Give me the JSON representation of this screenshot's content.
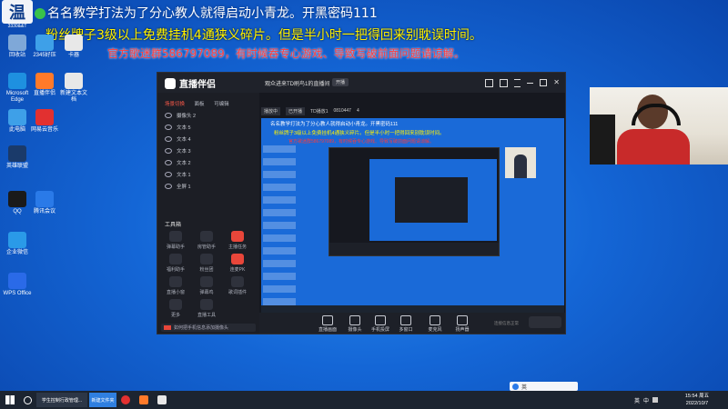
{
  "overlay": {
    "line1": "名名教学打法为了分心教人就得启动小青龙。开黑密码111",
    "line2": "粉丝牌子3级以上免费挂机4通狭义碎片。但是半小时一把得回来别耽误时间。",
    "line3": "官方歌迷群586797089，有时候吞专心游戏、导致写破前面问题请谅解。"
  },
  "corner_logo": {
    "text": "温",
    "sub": "3330&&T"
  },
  "desktop_icons": [
    {
      "label": "回收站",
      "color": "#7fa8d8"
    },
    {
      "label": "2345好压",
      "color": "#3ea0e8"
    },
    {
      "label": "卡器",
      "color": "#e8e8e8"
    },
    {
      "label": "Microsoft Edge",
      "color": "#1e90e0"
    },
    {
      "label": "直播伴侣",
      "color": "#ff7a2a"
    },
    {
      "label": "新建文本文档",
      "color": "#e8e8e8"
    },
    {
      "label": "此电脑",
      "color": "#3ea0e8"
    },
    {
      "label": "网易云音乐",
      "color": "#e23030"
    },
    {
      "label": "英雄联盟",
      "color": "#1a3a6a"
    },
    {
      "label": "QQ",
      "color": "#1a1a1a"
    },
    {
      "label": "腾讯会议",
      "color": "#2a7ae8"
    },
    {
      "label": "企业微信",
      "color": "#2a9ae8"
    },
    {
      "label": "WPS Office",
      "color": "#2a6ae8"
    }
  ],
  "app": {
    "title": "直播伴侣",
    "room_title": "观众进来TD刷鸟1的直播间",
    "room_tag": "开播",
    "tabs": [
      "场景切换",
      "面板",
      "可编辑"
    ],
    "sources": [
      "摄像头 2",
      "文本 5",
      "文本 4",
      "文本 3",
      "文本 2",
      "文本 1",
      "全屏 1"
    ],
    "tools_title": "工具箱",
    "tools": [
      "弹幕助手",
      "房管助手",
      "主播任务",
      "福利助手",
      "粉丝团",
      "连麦PK",
      "直播小窗",
      "弹幕鸡",
      "歌词插件",
      "更多",
      "直播工具"
    ],
    "topbar_items": [
      "播放中",
      "已开播",
      "TD播放1",
      "0810447",
      "4"
    ],
    "bottom_buttons": [
      "直播画面",
      "摄像头",
      "手机投屏",
      "多窗口",
      "麦克风",
      "扬声器"
    ],
    "bottom_status": "连接信息正常",
    "notice": "如何把手机信息添加摄像头"
  },
  "taskbar": {
    "apps": [
      "学生控制行政管理...",
      "新建文件夹"
    ],
    "tray": [
      "英",
      "中"
    ],
    "time": "15:54 周五",
    "date": "2022/10/7"
  }
}
